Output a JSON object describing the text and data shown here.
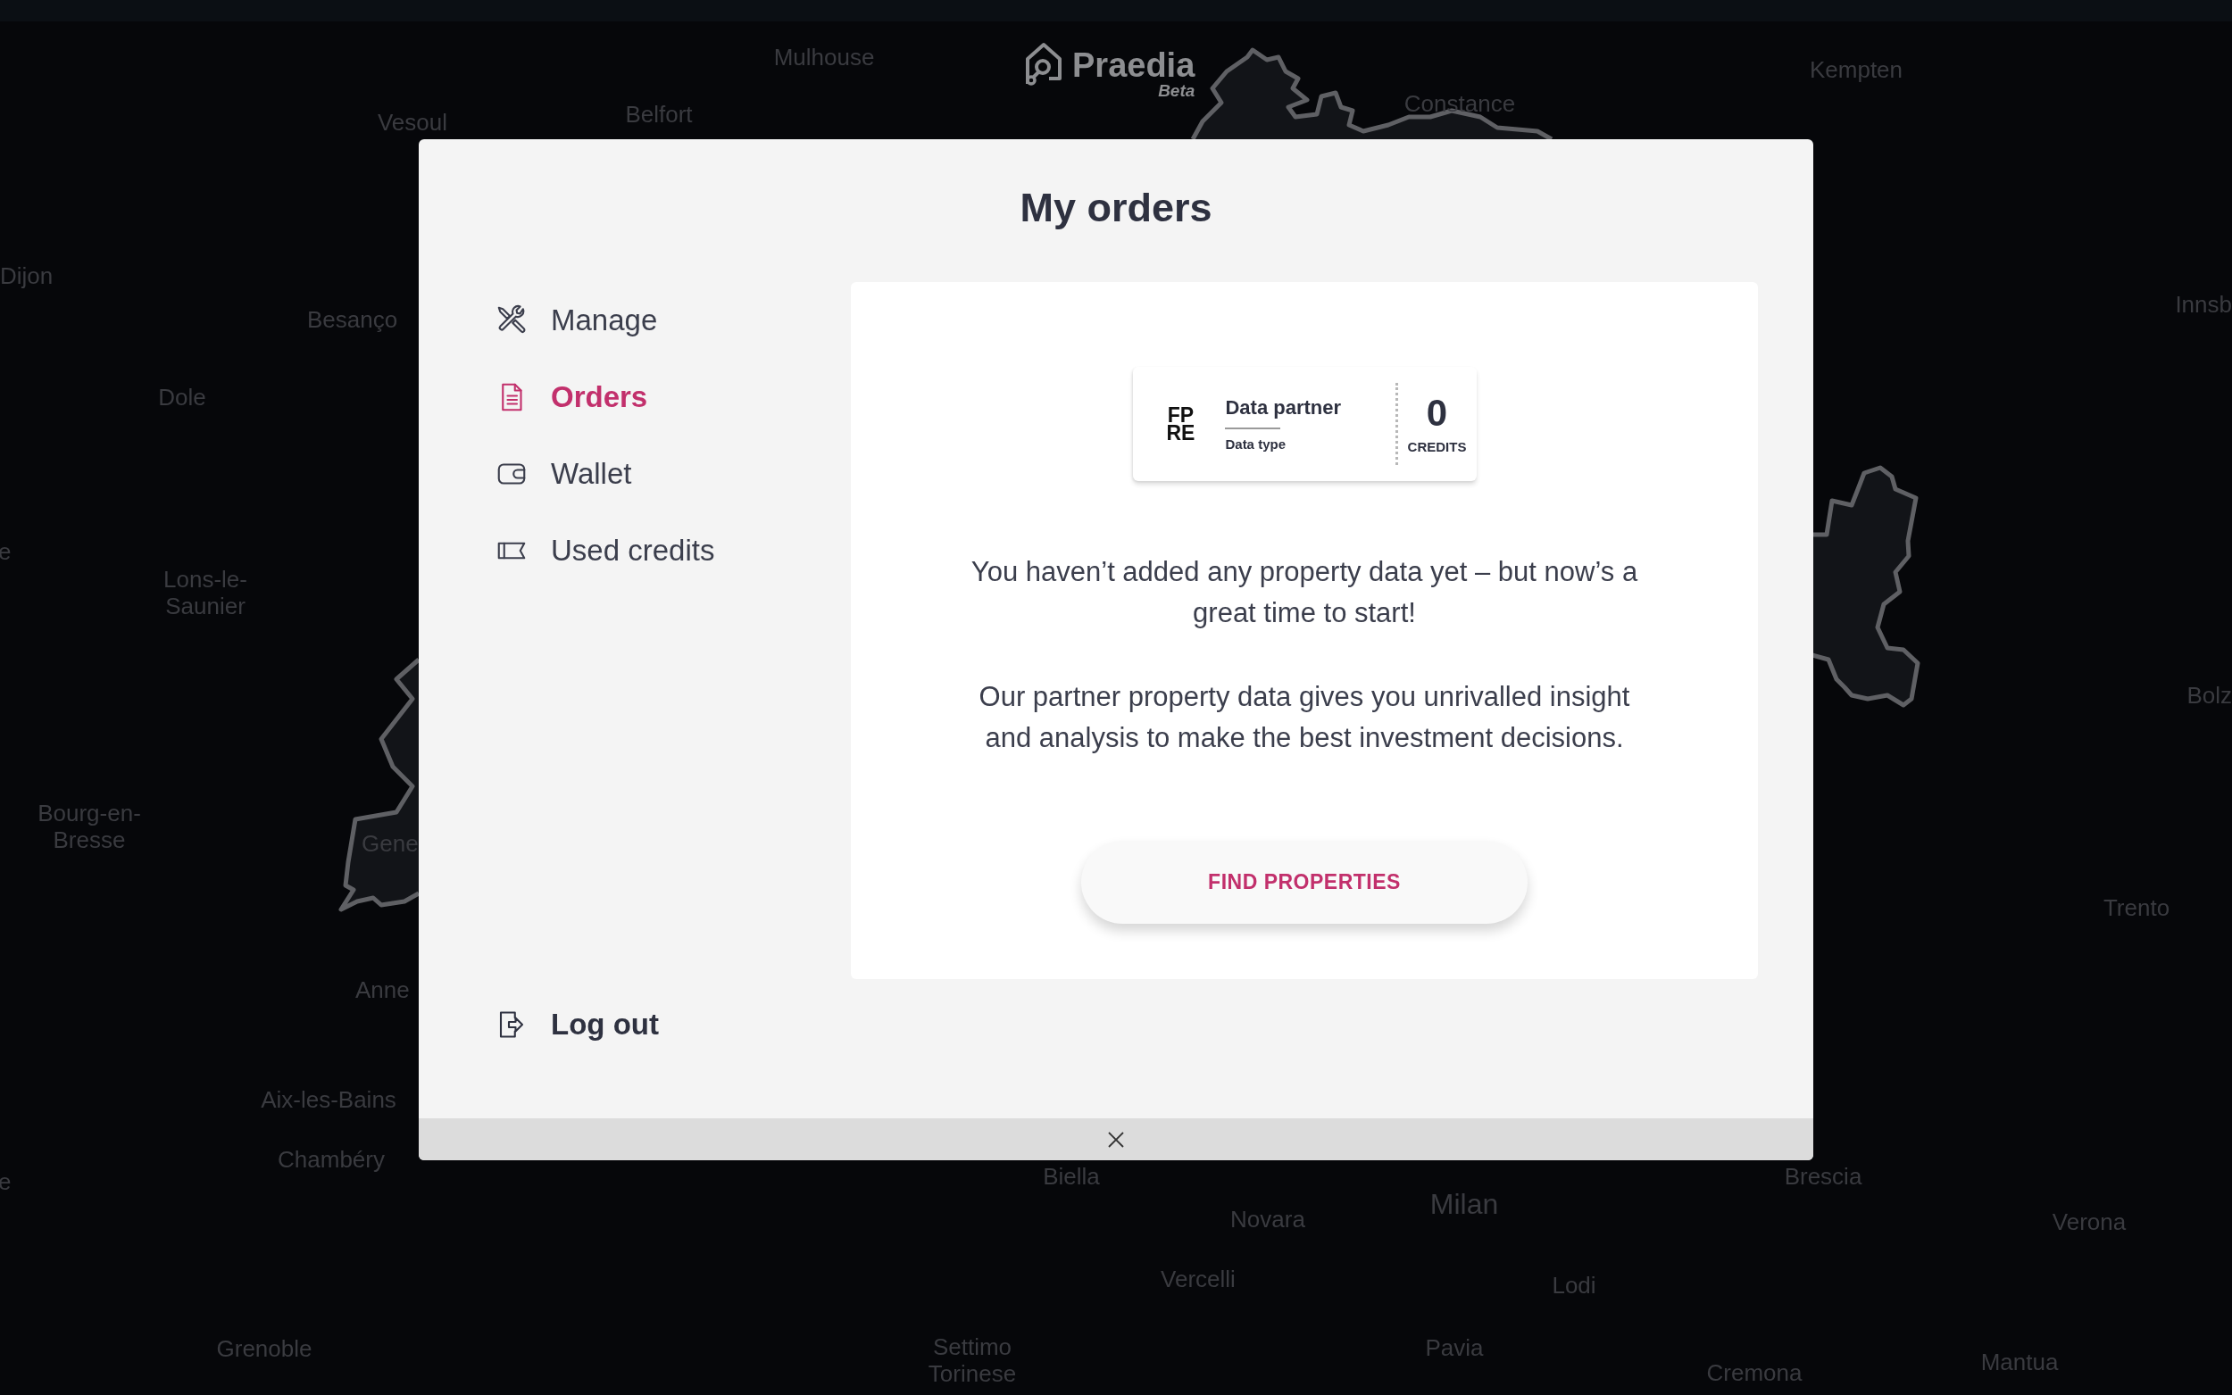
{
  "top_bar": {
    "logo": {
      "name": "Praedia",
      "tag": "Beta"
    }
  },
  "map": {
    "labels": [
      "Mulhouse",
      "Kempten",
      "Belfort",
      "Vesoul",
      "Constance",
      "Dijon",
      "Besanço",
      "Innsb",
      "Dole",
      "e",
      "Lons-le-Saunier",
      "Bourg-en-Bresse",
      "Gene",
      "Anne",
      "Bolz",
      "Trento",
      "Aix-les-Bains",
      "Chambéry",
      "Biella",
      "Brescia",
      "e",
      "Milan",
      "Novara",
      "Verona",
      "Vercelli",
      "Lodi",
      "Grenoble",
      "Settimo Torinese",
      "Pavia",
      "Mantua",
      "Cremona"
    ]
  },
  "modal": {
    "title": "My orders",
    "menu": [
      {
        "label": "Manage",
        "selected": false
      },
      {
        "label": "Orders",
        "selected": true
      },
      {
        "label": "Wallet",
        "selected": false
      },
      {
        "label": "Used credits",
        "selected": false
      }
    ],
    "logout": {
      "label": "Log out"
    },
    "product": {
      "logo": "FP RE",
      "name": "Data partner",
      "type": "Data type",
      "credits": "0",
      "credits_label": "CREDITS"
    },
    "message": [
      "You haven’t added any property data yet – but now’s a great time to start!",
      "Our partner property data gives you unrivalled insight and analysis to make the best investment decisions."
    ],
    "button": {
      "label": "FIND PROPERTIES"
    }
  }
}
